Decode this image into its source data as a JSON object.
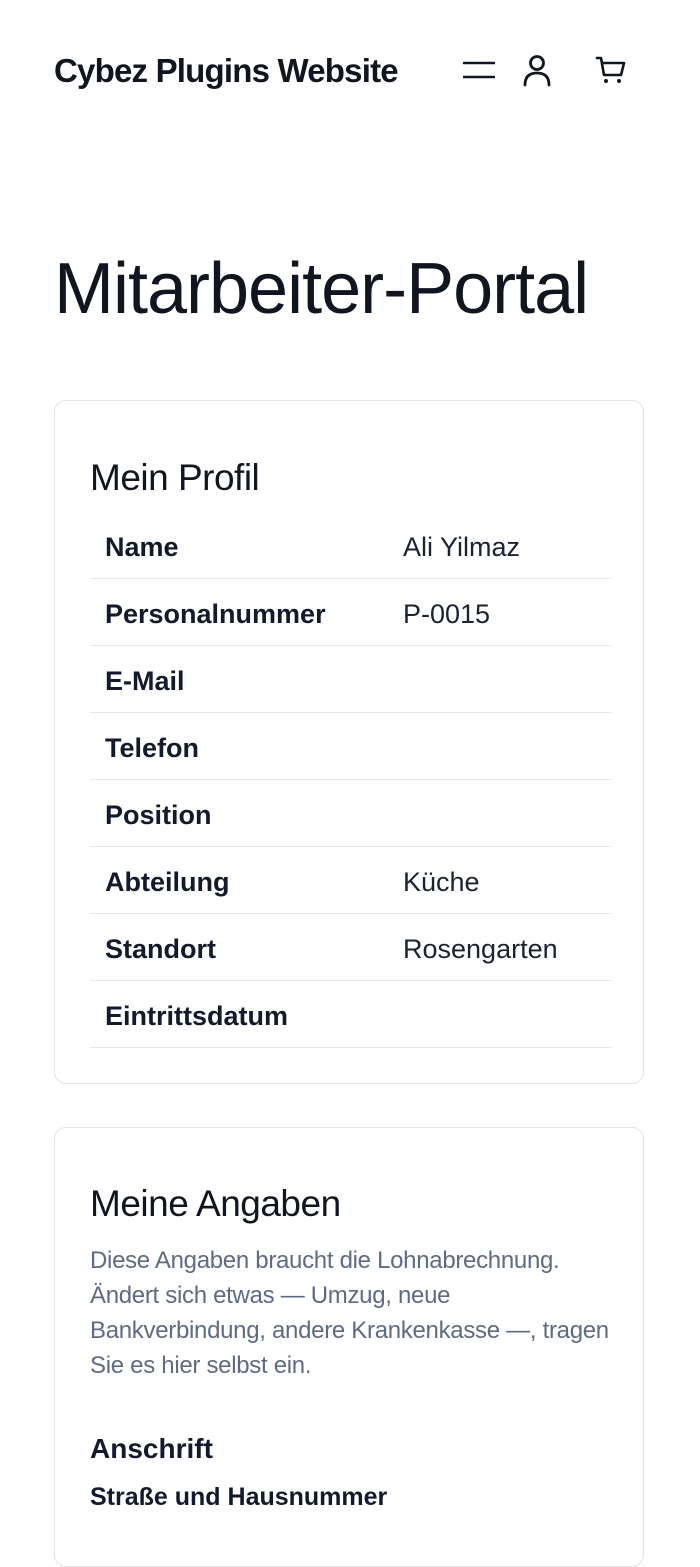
{
  "header": {
    "site_title": "Cybez Plugins Website",
    "icons": [
      "menu-icon",
      "account-icon",
      "cart-icon"
    ]
  },
  "page": {
    "title": "Mitarbeiter-Portal"
  },
  "profile": {
    "title": "Mein Profil",
    "rows": [
      {
        "label": "Name",
        "value": "Ali Yilmaz"
      },
      {
        "label": "Personalnummer",
        "value": "P-0015"
      },
      {
        "label": "E-Mail",
        "value": ""
      },
      {
        "label": "Telefon",
        "value": ""
      },
      {
        "label": "Position",
        "value": ""
      },
      {
        "label": "Abteilung",
        "value": "Küche"
      },
      {
        "label": "Standort",
        "value": "Rosengarten"
      },
      {
        "label": "Eintrittsdatum",
        "value": ""
      }
    ]
  },
  "details": {
    "title": "Meine Angaben",
    "intro_lines": [
      "Diese Angaben braucht die Lohnabrechnung.",
      "Ändert sich etwas — Umzug, neue",
      "Bankverbindung, andere Krankenkasse —, tragen",
      "Sie es hier selbst ein."
    ],
    "address_section": {
      "title": "Anschrift",
      "street_label": "Straße und Hausnummer"
    }
  },
  "colors": {
    "text_primary": "#11151f",
    "text_muted": "#5f6b82",
    "border": "#dfe3e8"
  }
}
